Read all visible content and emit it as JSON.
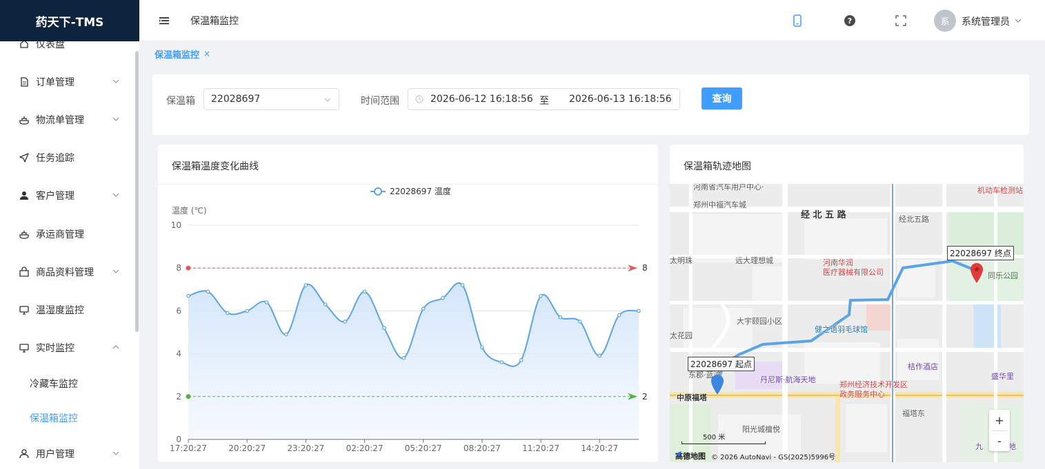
{
  "app": {
    "logo": "药天下-TMS"
  },
  "header": {
    "breadcrumb": "保温箱监控",
    "user_avatar": "系",
    "user_name": "系统管理员"
  },
  "sidebar": {
    "items": [
      {
        "label": "仪表盘",
        "icon": "dashboard-icon",
        "expandable": false
      },
      {
        "label": "订单管理",
        "icon": "document-icon",
        "expandable": true
      },
      {
        "label": "物流单管理",
        "icon": "tray-icon",
        "expandable": true
      },
      {
        "label": "任务追踪",
        "icon": "navigation-icon",
        "expandable": false
      },
      {
        "label": "客户管理",
        "icon": "user-icon",
        "expandable": true
      },
      {
        "label": "承运商管理",
        "icon": "tray-icon",
        "expandable": false
      },
      {
        "label": "商品资料管理",
        "icon": "bag-icon",
        "expandable": true
      },
      {
        "label": "温湿度监控",
        "icon": "monitor-icon",
        "expandable": false
      },
      {
        "label": "实时监控",
        "icon": "monitor-icon",
        "expandable": true,
        "expanded": true
      },
      {
        "label": "用户管理",
        "icon": "user-outline-icon",
        "expandable": true
      }
    ],
    "submenu": [
      {
        "label": "冷藏车监控",
        "active": false
      },
      {
        "label": "保温箱监控",
        "active": true
      }
    ]
  },
  "tags": [
    {
      "label": "保温箱监控",
      "close": "×"
    }
  ],
  "filter": {
    "box_label": "保温箱",
    "box_value": "22028697",
    "time_label": "时间范围",
    "start": "2026-06-12 16:18:56",
    "separator": "至",
    "end": "2026-06-13 16:18:56",
    "query_button": "查询"
  },
  "chart_card": {
    "title": "保温箱温度变化曲线"
  },
  "map_card": {
    "title": "保温箱轨迹地图",
    "start_label": "22028697 起点",
    "end_label": "22028697 终点",
    "scale": "500 米",
    "brand": "高德地图",
    "copyright": "© 2026 AutoNavi - GS(2025)5996号",
    "zoom_in": "+",
    "zoom_out": "-",
    "labels": [
      {
        "text": "河南省汽车用户中心·",
        "color": "#555"
      },
      {
        "text": "郑州中福汽车城",
        "color": "#555"
      },
      {
        "text": "经 北 五 路",
        "color": "#333"
      },
      {
        "text": "经北五路",
        "color": "#555"
      },
      {
        "text": "机动车检测站",
        "color": "#d23c3c"
      },
      {
        "text": "太明珠",
        "color": "#555"
      },
      {
        "text": "远大理想城",
        "color": "#555"
      },
      {
        "text": "河南华润",
        "color": "#d23c3c"
      },
      {
        "text": "医疗器械有限公司",
        "color": "#d23c3c"
      },
      {
        "text": "同乐公园",
        "color": "#2e7d32"
      },
      {
        "text": "大宇颐园小区",
        "color": "#555"
      },
      {
        "text": "健之语羽毛球馆",
        "color": "#1f6fb5"
      },
      {
        "text": "太花园",
        "color": "#555"
      },
      {
        "text": "桔作酒店",
        "color": "#6a3fb5"
      },
      {
        "text": "盛华里",
        "color": "#6a3fb5"
      },
      {
        "text": "东郡·蓝湾",
        "color": "#555"
      },
      {
        "text": "丹尼斯·航海天地",
        "color": "#6a3fb5"
      },
      {
        "text": "郑州经济技术开发区",
        "color": "#d23c3c"
      },
      {
        "text": "政务服务中心",
        "color": "#d23c3c"
      },
      {
        "text": "中原福塔",
        "color": "#333"
      },
      {
        "text": "福塔东",
        "color": "#555"
      },
      {
        "text": "阳光城檀悦",
        "color": "#555"
      },
      {
        "text": "九",
        "color": "#6a3fb5"
      },
      {
        "text": "天地",
        "color": "#6a3fb5"
      }
    ]
  },
  "chart_data": {
    "type": "line",
    "legend": "22028697 温度",
    "ylabel": "温度 (℃)",
    "ylim": [
      0,
      10
    ],
    "yticks": [
      0,
      2,
      4,
      6,
      8,
      10
    ],
    "x_tick_labels": [
      "17:20:27",
      "20:20:27",
      "23:20:27",
      "02:20:27",
      "05:20:27",
      "08:20:27",
      "11:20:27",
      "14:20:27"
    ],
    "series": [
      {
        "name": "22028697 温度",
        "color": "#5aa4e6",
        "values": [
          6.7,
          6.9,
          5.9,
          6.0,
          6.4,
          4.9,
          7.2,
          6.3,
          5.5,
          6.9,
          5.2,
          3.8,
          6.1,
          6.6,
          7.2,
          4.3,
          3.6,
          3.7,
          6.7,
          5.7,
          5.5,
          3.9,
          5.8,
          6.0
        ]
      }
    ],
    "thresholds": [
      {
        "value": 8,
        "label": "8",
        "color": "#e05a5a"
      },
      {
        "value": 2,
        "label": "2",
        "color": "#52b33c"
      }
    ]
  }
}
